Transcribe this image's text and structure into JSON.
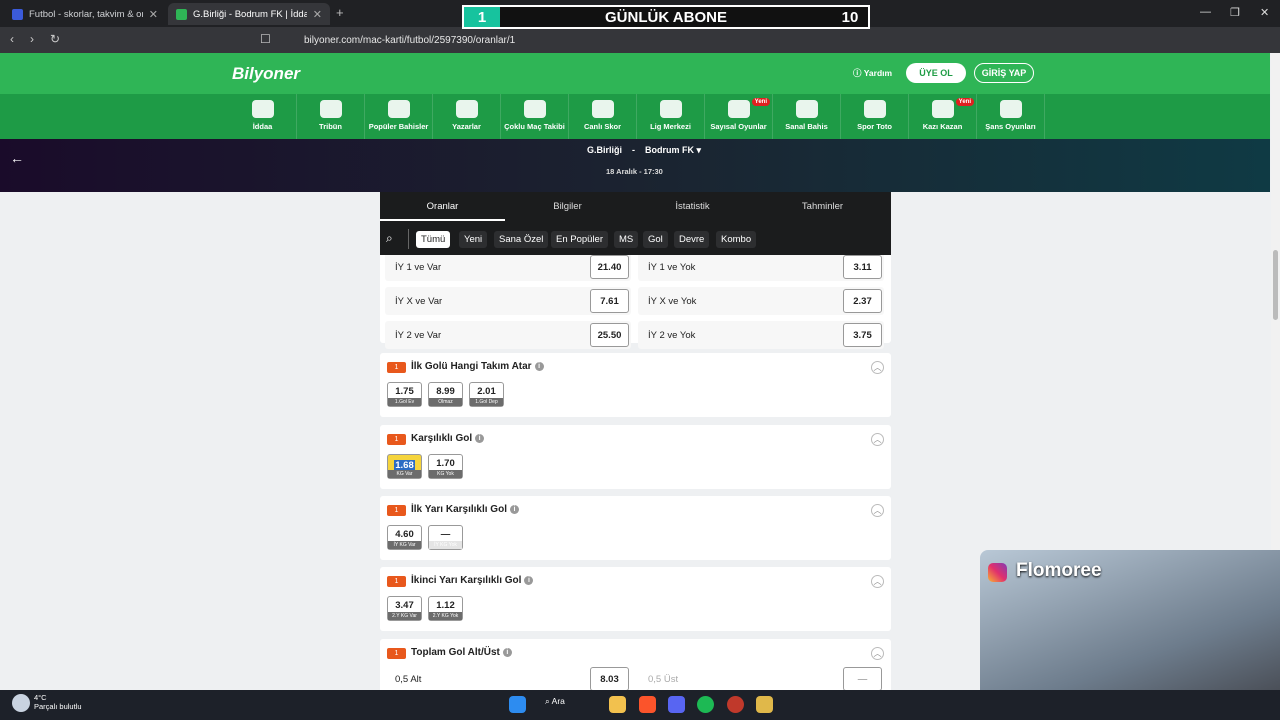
{
  "browser": {
    "tabs": [
      {
        "title": "Futbol - skorlar, takvim & oranlar | Sc",
        "color": "#3b5bdb"
      },
      {
        "title": "G.Birliği - Bodrum FK | İddaa Or...",
        "color": "#2fb556"
      }
    ],
    "new_tab": "+",
    "url": "bilyoner.com/mac-karti/futbol/2597390/oranlar/1",
    "window_controls": [
      "—",
      "❐",
      "✕"
    ]
  },
  "overlay": {
    "left_num": "1",
    "label": "GÜNLÜK ABONE",
    "right_num": "10"
  },
  "site": {
    "logo": "Bilyoner",
    "help": "Yardım",
    "signup": "ÜYE OL",
    "login": "GİRİŞ YAP",
    "nav": [
      {
        "label": "İddaa",
        "new": ""
      },
      {
        "label": "Tribün",
        "new": ""
      },
      {
        "label": "Popüler Bahisler",
        "new": ""
      },
      {
        "label": "Yazarlar",
        "new": ""
      },
      {
        "label": "Çoklu Maç Takibi",
        "new": ""
      },
      {
        "label": "Canlı Skor",
        "new": ""
      },
      {
        "label": "Lig Merkezi",
        "new": ""
      },
      {
        "label": "Sayısal Oyunlar",
        "new": "Yeni"
      },
      {
        "label": "Sanal Bahis",
        "new": ""
      },
      {
        "label": "Spor Toto",
        "new": ""
      },
      {
        "label": "Kazı Kazan",
        "new": "Yeni"
      },
      {
        "label": "Şans Oyunları",
        "new": ""
      }
    ]
  },
  "match": {
    "home": "G.Birliği",
    "sep": "-",
    "away": "Bodrum FK ▾",
    "date": "18 Aralık - 17:30"
  },
  "tabs": [
    "Oranlar",
    "Bilgiler",
    "İstatistik",
    "Tahminler"
  ],
  "filters": [
    "Tümü",
    "Yeni",
    "Sana Özel",
    "En Popüler",
    "MS",
    "Gol",
    "Devre",
    "Kombo"
  ],
  "rows_top": [
    {
      "l1": "İY 1 ve Var",
      "v1": "21.40",
      "l2": "İY 1 ve Yok",
      "v2": "3.11"
    },
    {
      "l1": "İY X ve Var",
      "v1": "7.61",
      "l2": "İY X ve Yok",
      "v2": "2.37"
    },
    {
      "l1": "İY 2 ve Var",
      "v1": "25.50",
      "l2": "İY 2 ve Yok",
      "v2": "3.75"
    }
  ],
  "markets": [
    {
      "badge": "1",
      "title": "İlk Golü Hangi Takım Atar",
      "odds": [
        {
          "v": "1.75",
          "l": "1.Gol Ev"
        },
        {
          "v": "8.99",
          "l": "Olmaz"
        },
        {
          "v": "2.01",
          "l": "1.Gol Dep"
        }
      ]
    },
    {
      "badge": "1",
      "title": "Karşılıklı Gol",
      "odds": [
        {
          "v": "1.68",
          "l": "KG Var"
        },
        {
          "v": "1.70",
          "l": "KG Yok"
        }
      ]
    },
    {
      "badge": "1",
      "title": "İlk Yarı Karşılıklı Gol",
      "odds": [
        {
          "v": "4.60",
          "l": "İY KG Var"
        },
        {
          "v": "—",
          "l": "İY KG Yok"
        }
      ]
    },
    {
      "badge": "1",
      "title": "İkinci Yarı Karşılıklı Gol",
      "odds": [
        {
          "v": "3.47",
          "l": "2.Y KG Var"
        },
        {
          "v": "1.12",
          "l": "2.Y KG Yok"
        }
      ]
    },
    {
      "badge": "1",
      "title": "Toplam Gol Alt/Üst",
      "odds": []
    }
  ],
  "totals_row": {
    "l1": "0,5 Alt",
    "v1": "8.03",
    "l2": "0,5 Üst",
    "v2": "—"
  },
  "webcam": {
    "name": "Flomoree"
  },
  "taskbar": {
    "temp": "4°C",
    "weather": "Parçalı bulutlu",
    "search": "Ara"
  }
}
